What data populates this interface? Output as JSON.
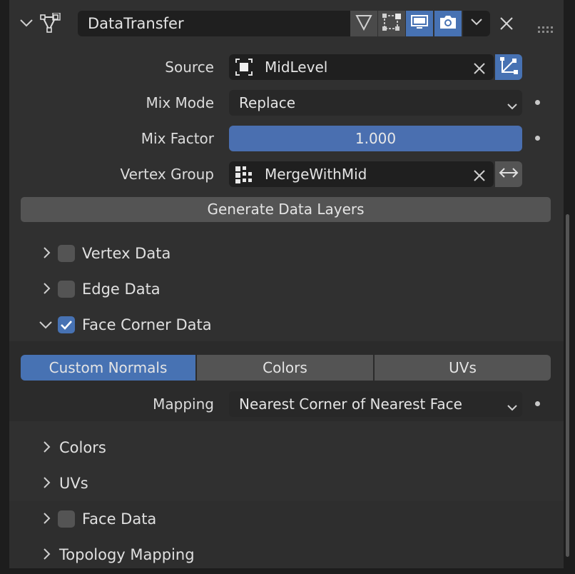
{
  "modifier": {
    "name": "DataTransfer"
  },
  "fields": {
    "source_label": "Source",
    "source_value": "MidLevel",
    "mix_mode_label": "Mix Mode",
    "mix_mode_value": "Replace",
    "mix_factor_label": "Mix Factor",
    "mix_factor_value": "1.000",
    "vertex_group_label": "Vertex Group",
    "vertex_group_value": "MergeWithMid"
  },
  "generate_button": "Generate Data Layers",
  "sections": {
    "vertex_data": "Vertex Data",
    "edge_data": "Edge Data",
    "face_corner_data": "Face Corner Data",
    "face_data": "Face Data",
    "topology_mapping": "Topology Mapping"
  },
  "face_corner": {
    "tabs": [
      "Custom Normals",
      "Colors",
      "UVs"
    ],
    "active_tab": "Custom Normals",
    "mapping_label": "Mapping",
    "mapping_value": "Nearest Corner of Nearest Face",
    "sub_colors": "Colors",
    "sub_uvs": "UVs"
  },
  "colors": {
    "accent": "#4772b3",
    "panel": "#303030",
    "field": "#1f1f1f"
  }
}
